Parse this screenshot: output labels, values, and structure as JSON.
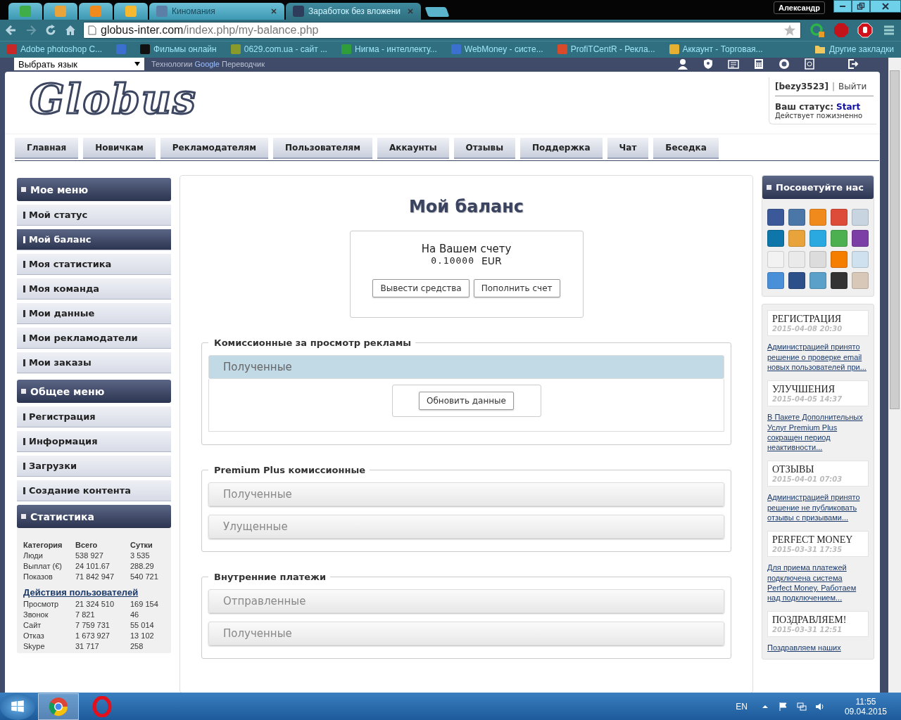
{
  "browser": {
    "profile": "Александр",
    "tabs": [
      {
        "selected": false,
        "color": "#3fae49"
      },
      {
        "selected": false,
        "color": "#e8a33a"
      },
      {
        "selected": false,
        "color": "#f08a1c"
      },
      {
        "selected": false,
        "color": "#f5b82e"
      },
      {
        "title": "Киномания",
        "selected": false,
        "color": "#5b7fa6"
      },
      {
        "title": "Заработок без вложени",
        "selected": true,
        "color": "#2f3d5c"
      }
    ],
    "address": {
      "host": "globus-inter.com",
      "path": "/index.php/my-balance.php"
    },
    "bookmarks": [
      {
        "label": "Adobe photoshop C...",
        "color": "#c62828"
      },
      {
        "color": "#3b6fd0"
      },
      {
        "label": "Фильмы онлайн",
        "color": "#111111"
      },
      {
        "label": "0629.com.ua - сайт ...",
        "color": "#8a9a2a"
      },
      {
        "label": "Нигма - интеллекту...",
        "color": "#2e9d3a"
      },
      {
        "label": "WebMoney - систе...",
        "color": "#3b6fd0"
      },
      {
        "label": "ProfiTCentR - Рекла...",
        "color": "#d84a2a"
      },
      {
        "label": "Аккаунт - Торговая...",
        "color": "#e8b030"
      }
    ],
    "other_bookmarks": "Другие закладки"
  },
  "topbar": {
    "language": "Выбрать язык",
    "translate_prefix": "Технологии",
    "translate_brand": "Google",
    "translate_suffix": "Переводчик"
  },
  "header": {
    "logo": "Globus",
    "username": "[bezy3523]",
    "separator": "|",
    "logout": "Выйти",
    "status_label": "Ваш статус:",
    "status_value": "Start",
    "status_note": "Действует пожизненно"
  },
  "nav": [
    "Главная",
    "Новичкам",
    "Рекламодателям",
    "Пользователям",
    "Аккаунты",
    "Отзывы",
    "Поддержка",
    "Чат",
    "Беседка"
  ],
  "left_menus": [
    {
      "title": "Мое меню",
      "items": [
        {
          "label": "Мой статус",
          "selected": false
        },
        {
          "label": "Мой баланс",
          "selected": true
        },
        {
          "label": "Моя статистика",
          "selected": false
        },
        {
          "label": "Моя команда",
          "selected": false
        },
        {
          "label": "Мои данные",
          "selected": false
        },
        {
          "label": "Мои рекламодатели",
          "selected": false
        },
        {
          "label": "Мои заказы",
          "selected": false
        }
      ]
    },
    {
      "title": "Общее меню",
      "items": [
        {
          "label": "Регистрация",
          "selected": false
        },
        {
          "label": "Информация",
          "selected": false
        },
        {
          "label": "Загрузки",
          "selected": false
        },
        {
          "label": "Создание контента",
          "selected": false
        }
      ]
    }
  ],
  "stats": {
    "title": "Статистика",
    "columns": [
      "Категория",
      "Всего",
      "Сутки"
    ],
    "rows": [
      [
        "Люди",
        "538 927",
        "3 535"
      ],
      [
        "Выплат (€)",
        "24 101.67",
        "288.29"
      ],
      [
        "Показов",
        "71 842 947",
        "540 721"
      ]
    ],
    "link": "Действия пользователей",
    "rows2": [
      [
        "Просмотр",
        "21 324 510",
        "169 154"
      ],
      [
        "Звонок",
        "7 821",
        "46"
      ],
      [
        "Сайт",
        "7 759 731",
        "55 014"
      ],
      [
        "Отказ",
        "1 673 927",
        "13 102"
      ],
      [
        "Skype",
        "31 717",
        "258"
      ]
    ]
  },
  "balance": {
    "title": "Мой баланс",
    "caption": "На Вашем счету",
    "amount": "0.10000",
    "currency": "EUR",
    "buttons": [
      "Вывести средства",
      "Пополнить счет"
    ]
  },
  "sections": [
    {
      "legend": "Комиссионные за просмотр рекламы",
      "panels": [
        {
          "label": "Полученные",
          "expanded": true,
          "button": "Обновить данные"
        }
      ]
    },
    {
      "legend": "Premium Plus комиссионные",
      "panels": [
        {
          "label": "Полученные",
          "expanded": false
        },
        {
          "label": "Улущенные",
          "expanded": false
        }
      ]
    },
    {
      "legend": "Внутренние платежи",
      "panels": [
        {
          "label": "Отправленные",
          "expanded": false
        },
        {
          "label": "Полученные",
          "expanded": false
        }
      ]
    }
  ],
  "share": {
    "title": "Посоветуйте нас",
    "icons": [
      {
        "color": "#3b5998"
      },
      {
        "color": "#4a76a8"
      },
      {
        "color": "#f08a1c"
      },
      {
        "color": "#dd4b39"
      },
      {
        "color": "#c8d4e0"
      },
      {
        "color": "#0e76a8"
      },
      {
        "color": "#e8a33a"
      },
      {
        "color": "#2aa9e0"
      },
      {
        "color": "#4caf50"
      },
      {
        "color": "#7b3fa6"
      },
      {
        "color": "#f2f2f2"
      },
      {
        "color": "#eaeaea"
      },
      {
        "color": "#dcdcdc"
      },
      {
        "color": "#f57d00"
      },
      {
        "color": "#cfe0ee"
      },
      {
        "color": "#4a90d9"
      },
      {
        "color": "#2d4f8a"
      },
      {
        "color": "#5aa0c8"
      },
      {
        "color": "#333333"
      },
      {
        "color": "#d8c8b8"
      }
    ]
  },
  "news": [
    {
      "title": "РЕГИСТРАЦИЯ",
      "date": "2015-04-08 20:30",
      "text": "Администрацией принято решение о проверке email новых пользователей при..."
    },
    {
      "title": "УЛУЧШЕНИЯ",
      "date": "2015-04-05 14:37",
      "text": "В Пакете Дополнительных Услуг Premium Plus сокращен период неактивности..."
    },
    {
      "title": "ОТЗЫВЫ",
      "date": "2015-04-01 07:03",
      "text": "Администрацией принято решение не публиковать отзывы с призывами..."
    },
    {
      "title": "PERFECT MONEY",
      "date": "2015-03-31 17:35",
      "text": "Для приема платежей подключена система Perfect Money. Работаем над подключением..."
    },
    {
      "title": "ПОЗДРАВЛЯЕМ!",
      "date": "2015-03-31 12:51",
      "text": "Поздравляем наших"
    }
  ],
  "taskbar": {
    "language": "EN",
    "time": "11:55",
    "date": "09.04.2015"
  }
}
